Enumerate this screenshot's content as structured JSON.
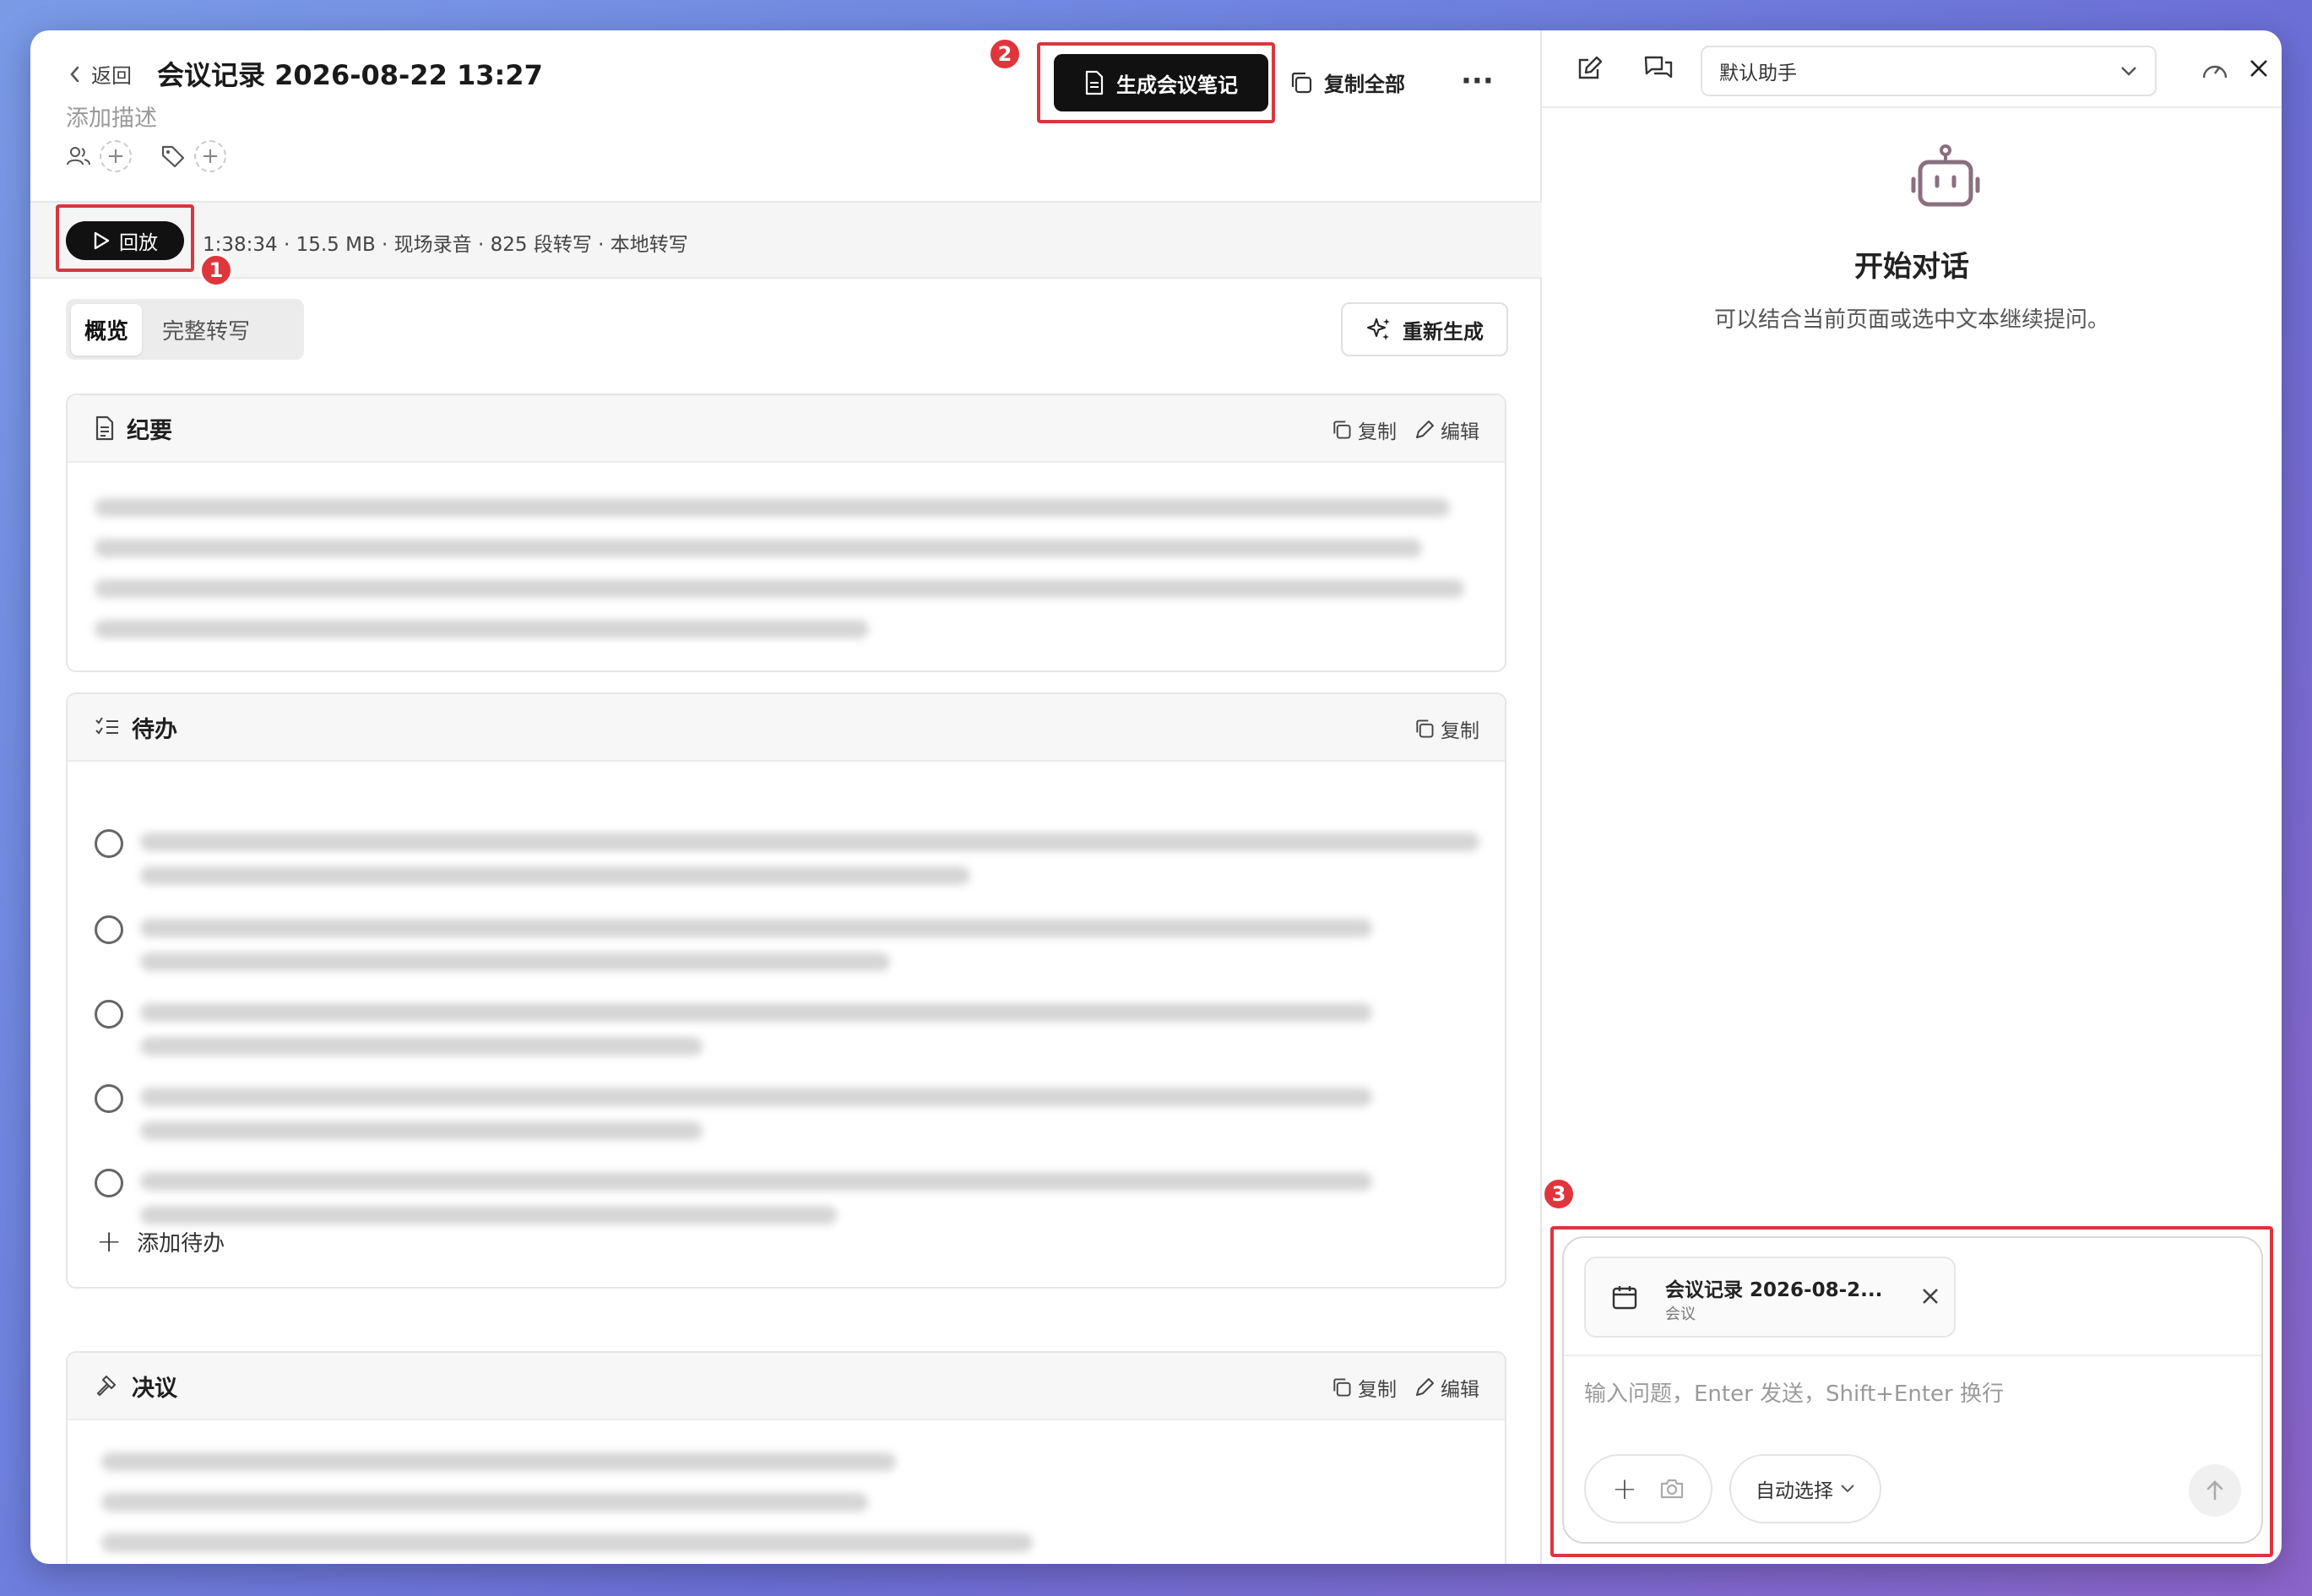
{
  "header": {
    "back_label": "返回",
    "title": "会议记录 2026-08-22 13:27",
    "description_placeholder": "添加描述",
    "generate_label": "生成会议笔记",
    "copy_all_label": "复制全部",
    "more_label": "···"
  },
  "playback": {
    "play_label": "回放",
    "info": "1:38:34 · 15.5 MB · 现场录音 · 825 段转写 · 本地转写"
  },
  "tabs": [
    {
      "label": "概览"
    },
    {
      "label": "完整转写"
    }
  ],
  "regenerate_label": "重新生成",
  "sections": {
    "summary": {
      "title": "纪要",
      "copy": "复制",
      "edit": "编辑"
    },
    "todos": {
      "title": "待办",
      "copy": "复制",
      "add_label": "添加待办"
    },
    "decisions": {
      "title": "决议",
      "copy": "复制",
      "edit": "编辑"
    }
  },
  "annotations": [
    "1",
    "2",
    "3"
  ],
  "assistant": {
    "selector_label": "默认助手",
    "empty_title": "开始对话",
    "empty_subtitle": "可以结合当前页面或选中文本继续提问。",
    "context_chip": {
      "title": "会议记录 2026-08-2...",
      "subtitle": "会议"
    },
    "input_placeholder": "输入问题，Enter 发送，Shift+Enter 换行",
    "model_select_label": "自动选择"
  },
  "colors": {
    "accent_dark": "#111111",
    "annotation_red": "#d9363e"
  }
}
